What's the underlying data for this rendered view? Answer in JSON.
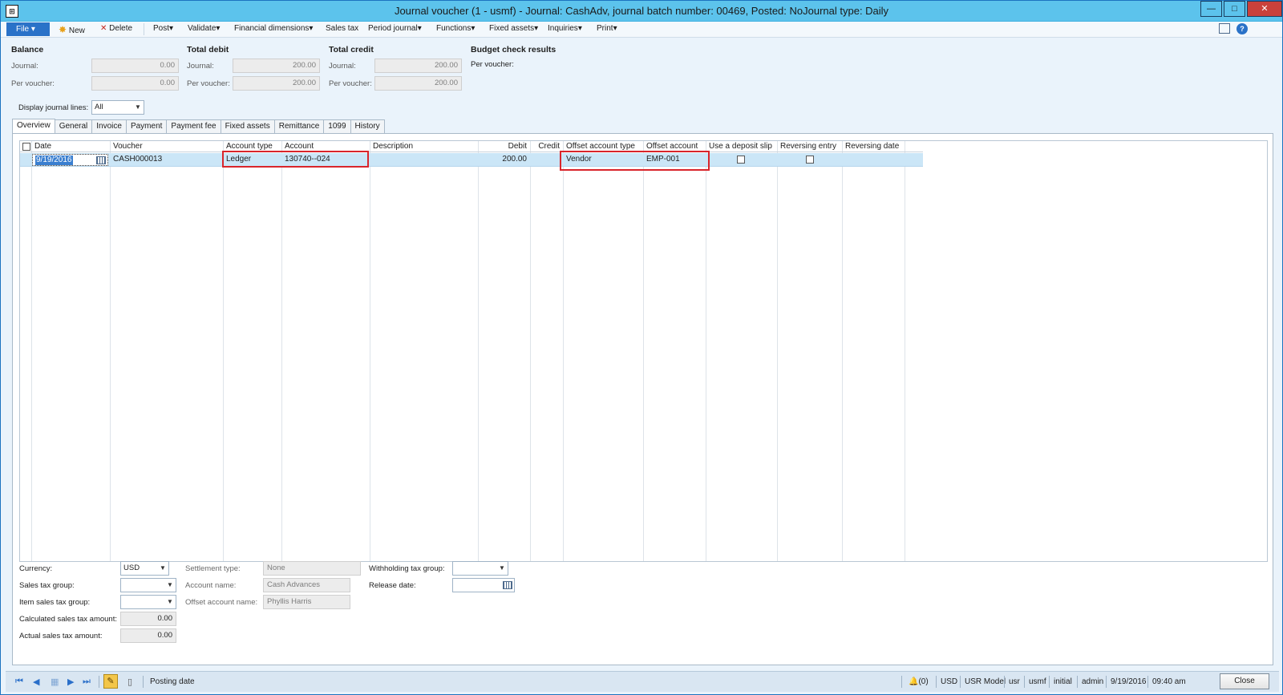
{
  "window": {
    "title": "Journal voucher (1 - usmf) - Journal: CashAdv, journal batch number: 00469, Posted: NoJournal type: Daily",
    "app_icon": "ax-icon"
  },
  "toolbar": {
    "file": "File",
    "new": "New",
    "delete": "Delete",
    "post": "Post",
    "validate": "Validate",
    "financial_dimensions": "Financial dimensions",
    "sales_tax": "Sales tax",
    "period_journal": "Period journal",
    "functions": "Functions",
    "fixed_assets": "Fixed assets",
    "inquiries": "Inquiries",
    "print": "Print"
  },
  "summary": {
    "balance": {
      "title": "Balance",
      "journal_label": "Journal:",
      "journal": "0.00",
      "per_voucher_label": "Per voucher:",
      "per_voucher": "0.00"
    },
    "total_debit": {
      "title": "Total debit",
      "journal_label": "Journal:",
      "journal": "200.00",
      "per_voucher_label": "Per voucher:",
      "per_voucher": "200.00"
    },
    "total_credit": {
      "title": "Total credit",
      "journal_label": "Journal:",
      "journal": "200.00",
      "per_voucher_label": "Per voucher:",
      "per_voucher": "200.00"
    },
    "budget": {
      "title": "Budget check results",
      "per_voucher_label": "Per voucher:"
    }
  },
  "display_lines": {
    "label": "Display journal lines:",
    "value": "All"
  },
  "tabs": [
    "Overview",
    "General",
    "Invoice",
    "Payment",
    "Payment fee",
    "Fixed assets",
    "Remittance",
    "1099",
    "History"
  ],
  "grid": {
    "columns": [
      "Date",
      "Voucher",
      "Account type",
      "Account",
      "Description",
      "Debit",
      "Credit",
      "Offset account type",
      "Offset account",
      "Use a deposit slip",
      "Reversing entry",
      "Reversing date"
    ],
    "rows": [
      {
        "date": "9/19/2016",
        "voucher": "CASH000013",
        "account_type": "Ledger",
        "account": "130740--024",
        "description": "",
        "debit": "200.00",
        "credit": "",
        "offset_account_type": "Vendor",
        "offset_account": "EMP-001",
        "deposit_slip": false,
        "reversing_entry": false,
        "reversing_date": ""
      }
    ]
  },
  "details": {
    "currency_label": "Currency:",
    "currency": "USD",
    "sales_tax_group_label": "Sales tax group:",
    "sales_tax_group": "",
    "item_sales_tax_group_label": "Item sales tax group:",
    "item_sales_tax_group": "",
    "calc_tax_label": "Calculated sales tax amount:",
    "calc_tax": "0.00",
    "actual_tax_label": "Actual sales tax amount:",
    "actual_tax": "0.00",
    "settlement_type_label": "Settlement type:",
    "settlement_type": "None",
    "account_name_label": "Account name:",
    "account_name": "Cash Advances",
    "offset_account_name_label": "Offset account name:",
    "offset_account_name": "Phyllis Harris",
    "withholding_label": "Withholding tax group:",
    "withholding": "",
    "release_date_label": "Release date:",
    "release_date": ""
  },
  "statusbar": {
    "field_hint": "Posting date",
    "alerts": "(0)",
    "currency": "USD",
    "model": "USR Model",
    "layer": "usr",
    "company": "usmf",
    "partition": "initial",
    "user": "admin",
    "date": "9/19/2016",
    "time": "09:40 am",
    "close": "Close"
  }
}
